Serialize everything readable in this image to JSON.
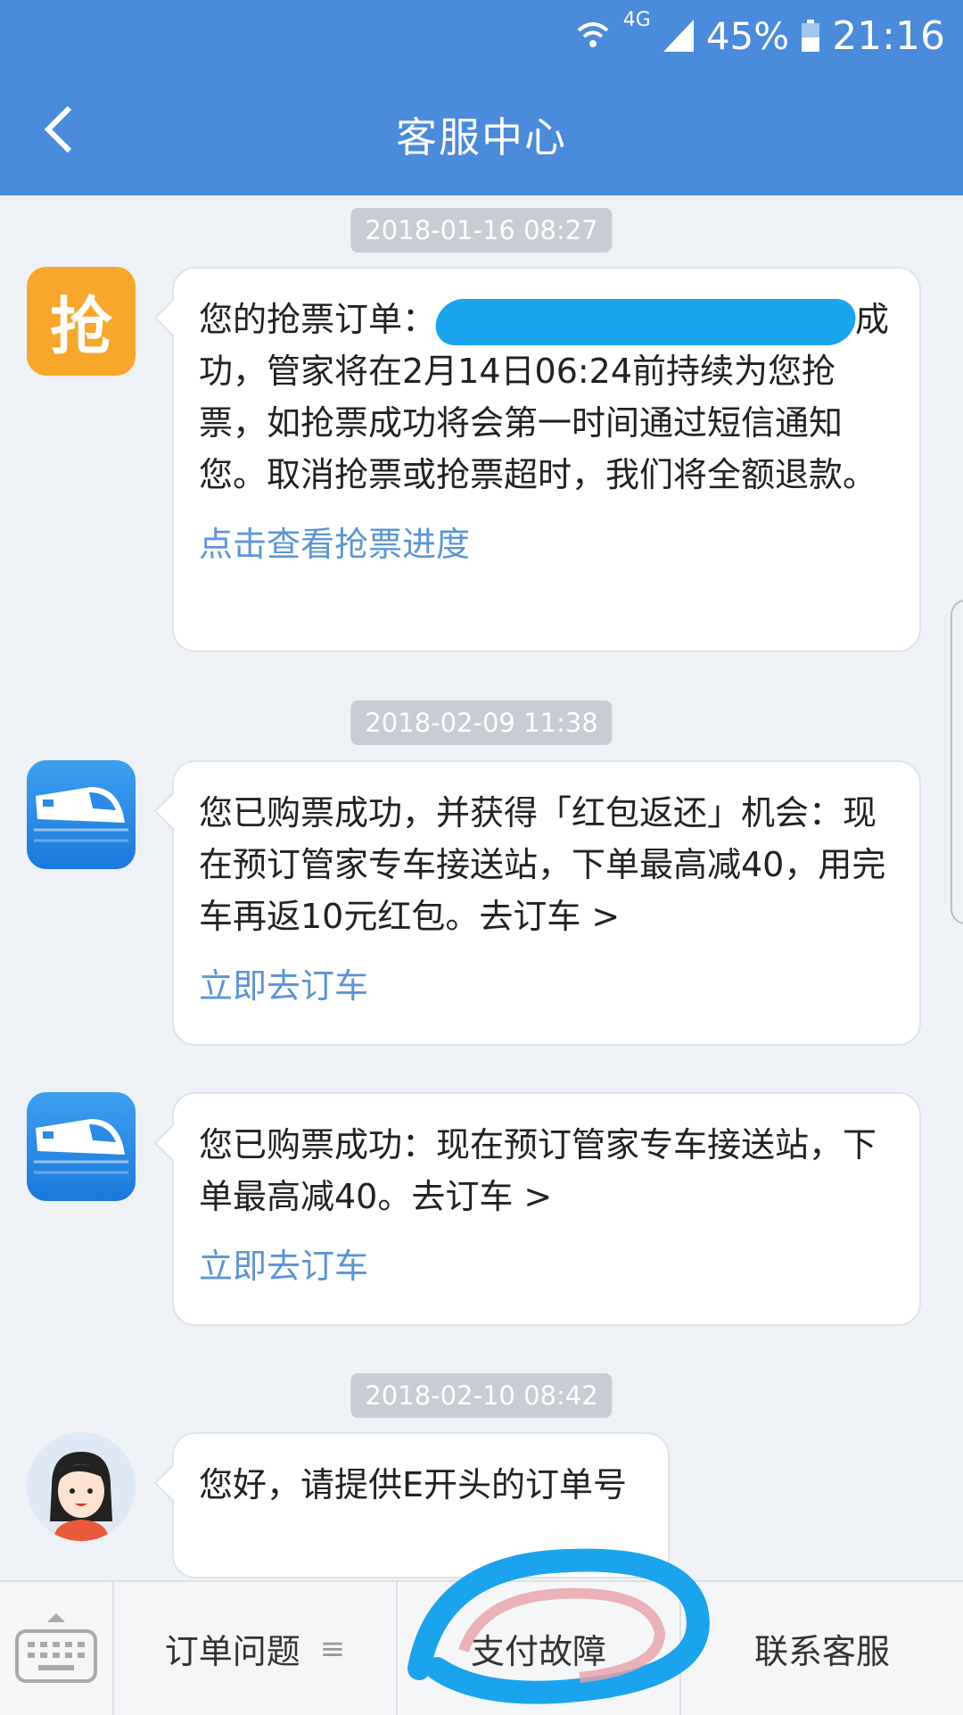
{
  "status_bar": {
    "network": "4G",
    "battery": "45%",
    "time": "21:16"
  },
  "header": {
    "title": "客服中心"
  },
  "messages": [
    {
      "timestamp": "2018-01-16 08:27",
      "avatar_text": "抢",
      "text_before": "您的抢票订单：",
      "text_after": "成功，管家将在2月14日06:24前持续为您抢票，如抢票成功将会第一时间通过短信通知您。取消抢票或抢票超时，我们将全额退款。",
      "link": "点击查看抢票进度"
    },
    {
      "timestamp": "2018-02-09 11:38",
      "text": "您已购票成功，并获得「红包返还」机会：现在预订管家专车接送站，下单最高减40，用完车再返10元红包。去订车 >",
      "link": "立即去订车"
    },
    {
      "text": "您已购票成功：现在预订管家专车接送站，下单最高减40。去订车 >",
      "link": "立即去订车"
    },
    {
      "timestamp": "2018-02-10 08:42",
      "text": "您好，请提供E开头的订单号"
    }
  ],
  "bottom_bar": {
    "items": [
      "订单问题",
      "支付故障",
      "联系客服"
    ],
    "order_menu_icon": "≡"
  },
  "colors": {
    "header": "#4a8bdb",
    "link": "#5b94d8",
    "grab_avatar": "#f8a72a"
  }
}
